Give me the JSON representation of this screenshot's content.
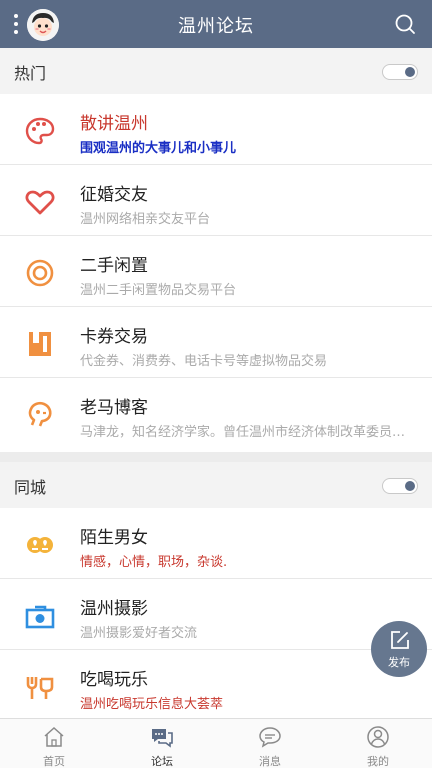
{
  "header": {
    "title": "温州论坛"
  },
  "sections": {
    "hot": {
      "title": "热门"
    },
    "local": {
      "title": "同城"
    }
  },
  "items": [
    {
      "title": "散讲温州",
      "desc": "围观温州的大事儿和小事儿",
      "icon": "palette-icon"
    },
    {
      "title": "征婚交友",
      "desc": "温州网络相亲交友平台",
      "icon": "heart-icon"
    },
    {
      "title": "二手闲置",
      "desc": "温州二手闲置物品交易平台",
      "icon": "target-icon"
    },
    {
      "title": "卡券交易",
      "desc": "代金券、消费券、电话卡号等虚拟物品交易",
      "icon": "coupon-icon"
    },
    {
      "title": "老马博客",
      "desc": "马津龙，知名经济学家。曾任温州市经济体制改革委员会主任",
      "icon": "head-icon"
    },
    {
      "title": "陌生男女",
      "desc": "情感，心情，职场，杂谈.",
      "icon": "couple-icon"
    },
    {
      "title": "温州摄影",
      "desc": "温州摄影爱好者交流",
      "icon": "camera-icon"
    },
    {
      "title": "吃喝玩乐",
      "desc": "温州吃喝玩乐信息大荟萃",
      "icon": "fork-cup-icon"
    }
  ],
  "fab": {
    "label": "发布"
  },
  "tabs": [
    {
      "label": "首页"
    },
    {
      "label": "论坛"
    },
    {
      "label": "消息"
    },
    {
      "label": "我的"
    }
  ],
  "colors": {
    "header": "#5a6b86",
    "icon_red": "#e0504a",
    "icon_orange": "#f09040",
    "icon_blue": "#2f8fe0",
    "highlight_red": "#c8382e",
    "highlight_blue": "#1a2fc4"
  }
}
